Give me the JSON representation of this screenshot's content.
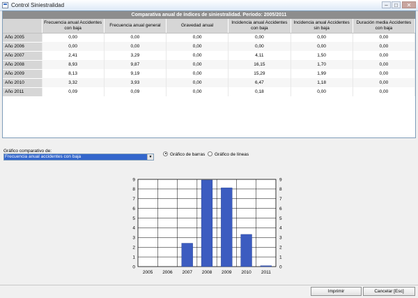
{
  "window": {
    "title": "Control Siniestralidad",
    "min_glyph": "–",
    "max_glyph": "□",
    "close_glyph": "✕"
  },
  "grid": {
    "caption": "Comparativa anual de índices de siniestralidad. Período: 2005/2011",
    "columns": [
      "Frecuencia anual Accidentes con baja",
      "Frecuencia anual general",
      "Gravedad anual",
      "Incidencia anual Accidentes con baja",
      "Incidencia anual Accidentes sin baja",
      "Duración media Accidentes con baja"
    ],
    "rows": [
      {
        "label": "Año 2005",
        "values": [
          "0,00",
          "0,00",
          "0,00",
          "0,00",
          "0,00",
          "0,00"
        ]
      },
      {
        "label": "Año 2006",
        "values": [
          "0,00",
          "0,00",
          "0,00",
          "0,00",
          "0,00",
          "0,00"
        ]
      },
      {
        "label": "Año 2007",
        "values": [
          "2,41",
          "3,29",
          "0,00",
          "4,11",
          "1,50",
          "0,00"
        ]
      },
      {
        "label": "Año 2008",
        "values": [
          "8,93",
          "9,87",
          "0,00",
          "16,15",
          "1,70",
          "0,00"
        ]
      },
      {
        "label": "Año 2009",
        "values": [
          "8,13",
          "9,19",
          "0,00",
          "15,29",
          "1,99",
          "0,00"
        ]
      },
      {
        "label": "Año 2010",
        "values": [
          "3,32",
          "3,93",
          "0,00",
          "6,47",
          "1,18",
          "0,00"
        ]
      },
      {
        "label": "Año 2011",
        "values": [
          "0,09",
          "0,09",
          "0,00",
          "0,18",
          "0,00",
          "0,00"
        ]
      }
    ]
  },
  "controls": {
    "compare_label": "Gráfico comparativo de:",
    "selected_metric": "Frecuencia anual accidentes con baja",
    "dropdown_glyph": "▼",
    "radio_bar": "Gráfico de barras",
    "radio_line": "Gráfico de líneas",
    "bar_selected": true
  },
  "chart_data": {
    "type": "bar",
    "categories": [
      "2005",
      "2006",
      "2007",
      "2008",
      "2009",
      "2010",
      "2011"
    ],
    "values": [
      0.0,
      0.0,
      2.41,
      8.93,
      8.13,
      3.32,
      0.09
    ],
    "ylim": [
      0,
      9
    ],
    "yticks": [
      "0",
      "1",
      "2",
      "3",
      "4",
      "5",
      "6",
      "7",
      "8",
      "9"
    ],
    "grid": true,
    "bar_color": "#3c5cc0"
  },
  "buttons": {
    "print": "Imprimir",
    "cancel": "Cancelar  [Esc]"
  }
}
